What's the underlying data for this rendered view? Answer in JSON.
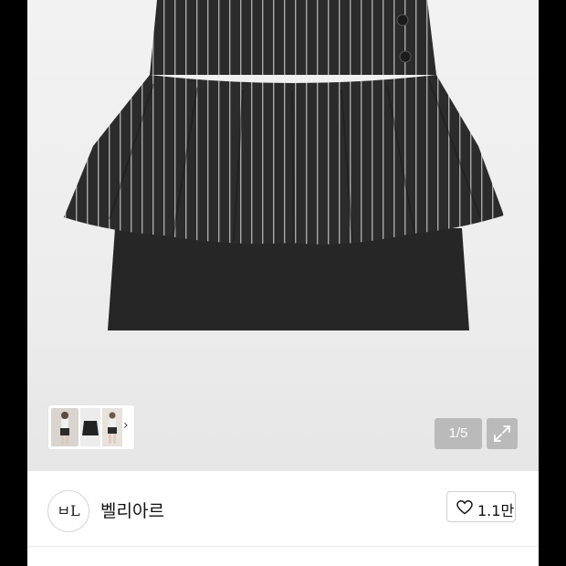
{
  "product": {
    "image_counter": "1/5",
    "thumbnails": [
      "model-photo",
      "skirt-flat-photo",
      "model-photo-2"
    ]
  },
  "seller": {
    "logo_text": "ㅂL",
    "name": "벨리아르"
  },
  "like": {
    "count": "1.1만"
  },
  "icons": {
    "thumbnail_next": "chevron-right-icon",
    "expand": "expand-icon",
    "like": "heart-icon"
  },
  "colors": {
    "skirt": "#2a2a2a",
    "stripe": "#bdbdbd",
    "overlay": "#8a8a8a"
  }
}
